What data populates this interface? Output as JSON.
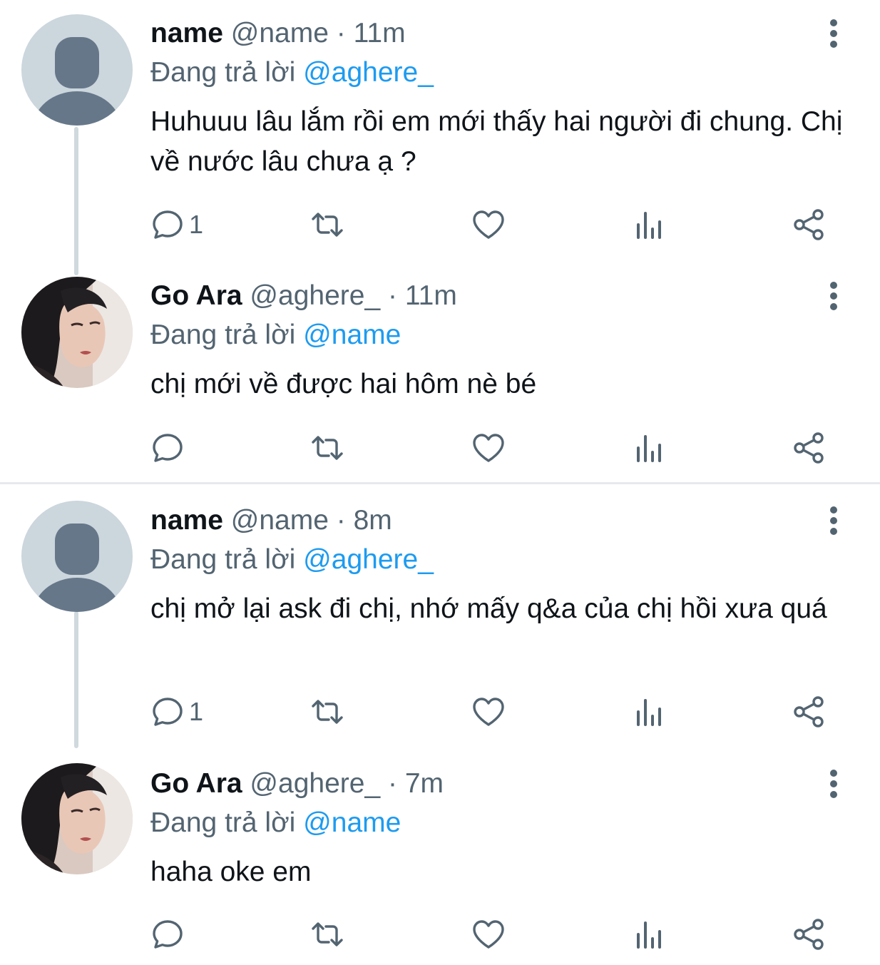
{
  "threads": [
    {
      "tweets": [
        {
          "display_name": "name",
          "handle": "@name",
          "separator": "·",
          "time": "11m",
          "reply_prefix": "Đang trả lời",
          "reply_to": "@aghere_",
          "text": "Huhuuu lâu lắm rồi em mới thấy hai người đi chung. Chị về nước lâu chưa ạ ?",
          "reply_count": "1",
          "avatar": "default-avatar"
        },
        {
          "display_name": "Go Ara",
          "handle": "@aghere_",
          "separator": "·",
          "time": "11m",
          "reply_prefix": "Đang trả lời",
          "reply_to": "@name",
          "text": "chị mới về được hai hôm nè bé",
          "reply_count": "",
          "avatar": "photo-avatar"
        }
      ]
    },
    {
      "tweets": [
        {
          "display_name": "name",
          "handle": "@name",
          "separator": "·",
          "time": "8m",
          "reply_prefix": "Đang trả lời",
          "reply_to": "@aghere_",
          "text": "chị mở lại ask đi chị, nhớ mấy q&a của chị hồi xưa quá",
          "reply_count": "1",
          "avatar": "default-avatar"
        },
        {
          "display_name": "Go Ara",
          "handle": "@aghere_",
          "separator": "·",
          "time": "7m",
          "reply_prefix": "Đang trả lời",
          "reply_to": "@name",
          "text": "haha oke em",
          "reply_count": "",
          "avatar": "photo-avatar"
        }
      ]
    }
  ],
  "icons": {
    "reply": "reply-icon",
    "retweet": "retweet-icon",
    "like": "heart-icon",
    "stats": "analytics-icon",
    "share": "share-icon",
    "more": "more-vertical-icon"
  },
  "colors": {
    "text": "#0f1419",
    "secondary": "#536471",
    "mention": "#1d9bf0",
    "thread_line": "#cfd9de",
    "divider": "#e6e9ec",
    "default_avatar_bg": "#ccd6dd",
    "default_avatar_fg": "#66778a"
  }
}
